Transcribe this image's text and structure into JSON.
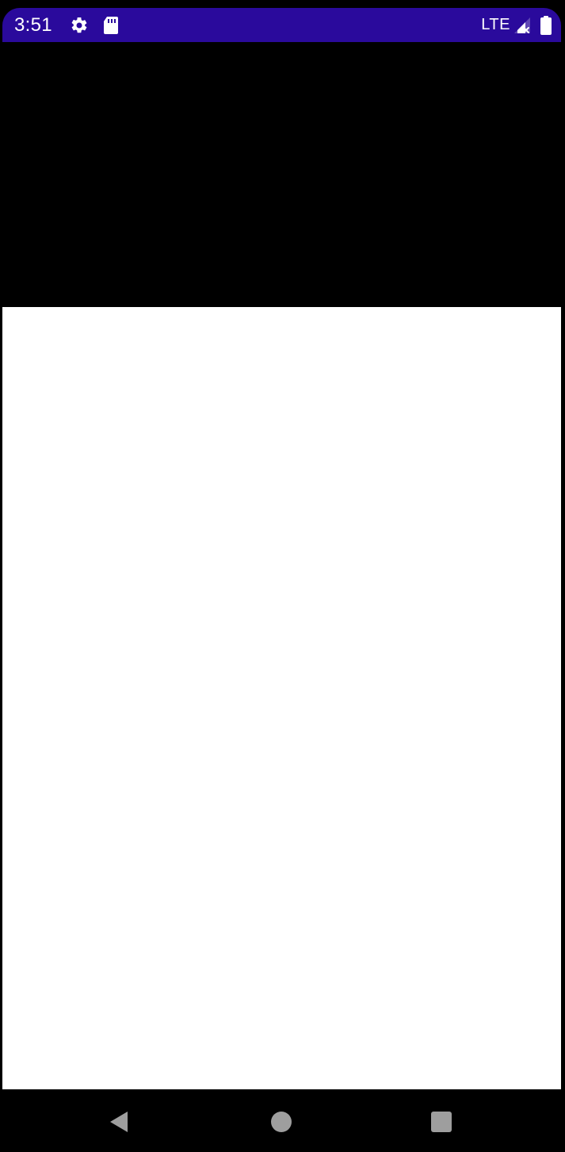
{
  "status_bar": {
    "time": "3:51",
    "network": "LTE",
    "background_color": "#2a0a9c",
    "icons": [
      "gear-icon",
      "sd-card-icon",
      "signal-icon",
      "battery-icon"
    ]
  },
  "navigation": {
    "buttons": [
      "back-icon",
      "home-icon",
      "recents-icon"
    ],
    "button_color": "#9e9e9e"
  },
  "content": {
    "background_color": "#ffffff"
  }
}
